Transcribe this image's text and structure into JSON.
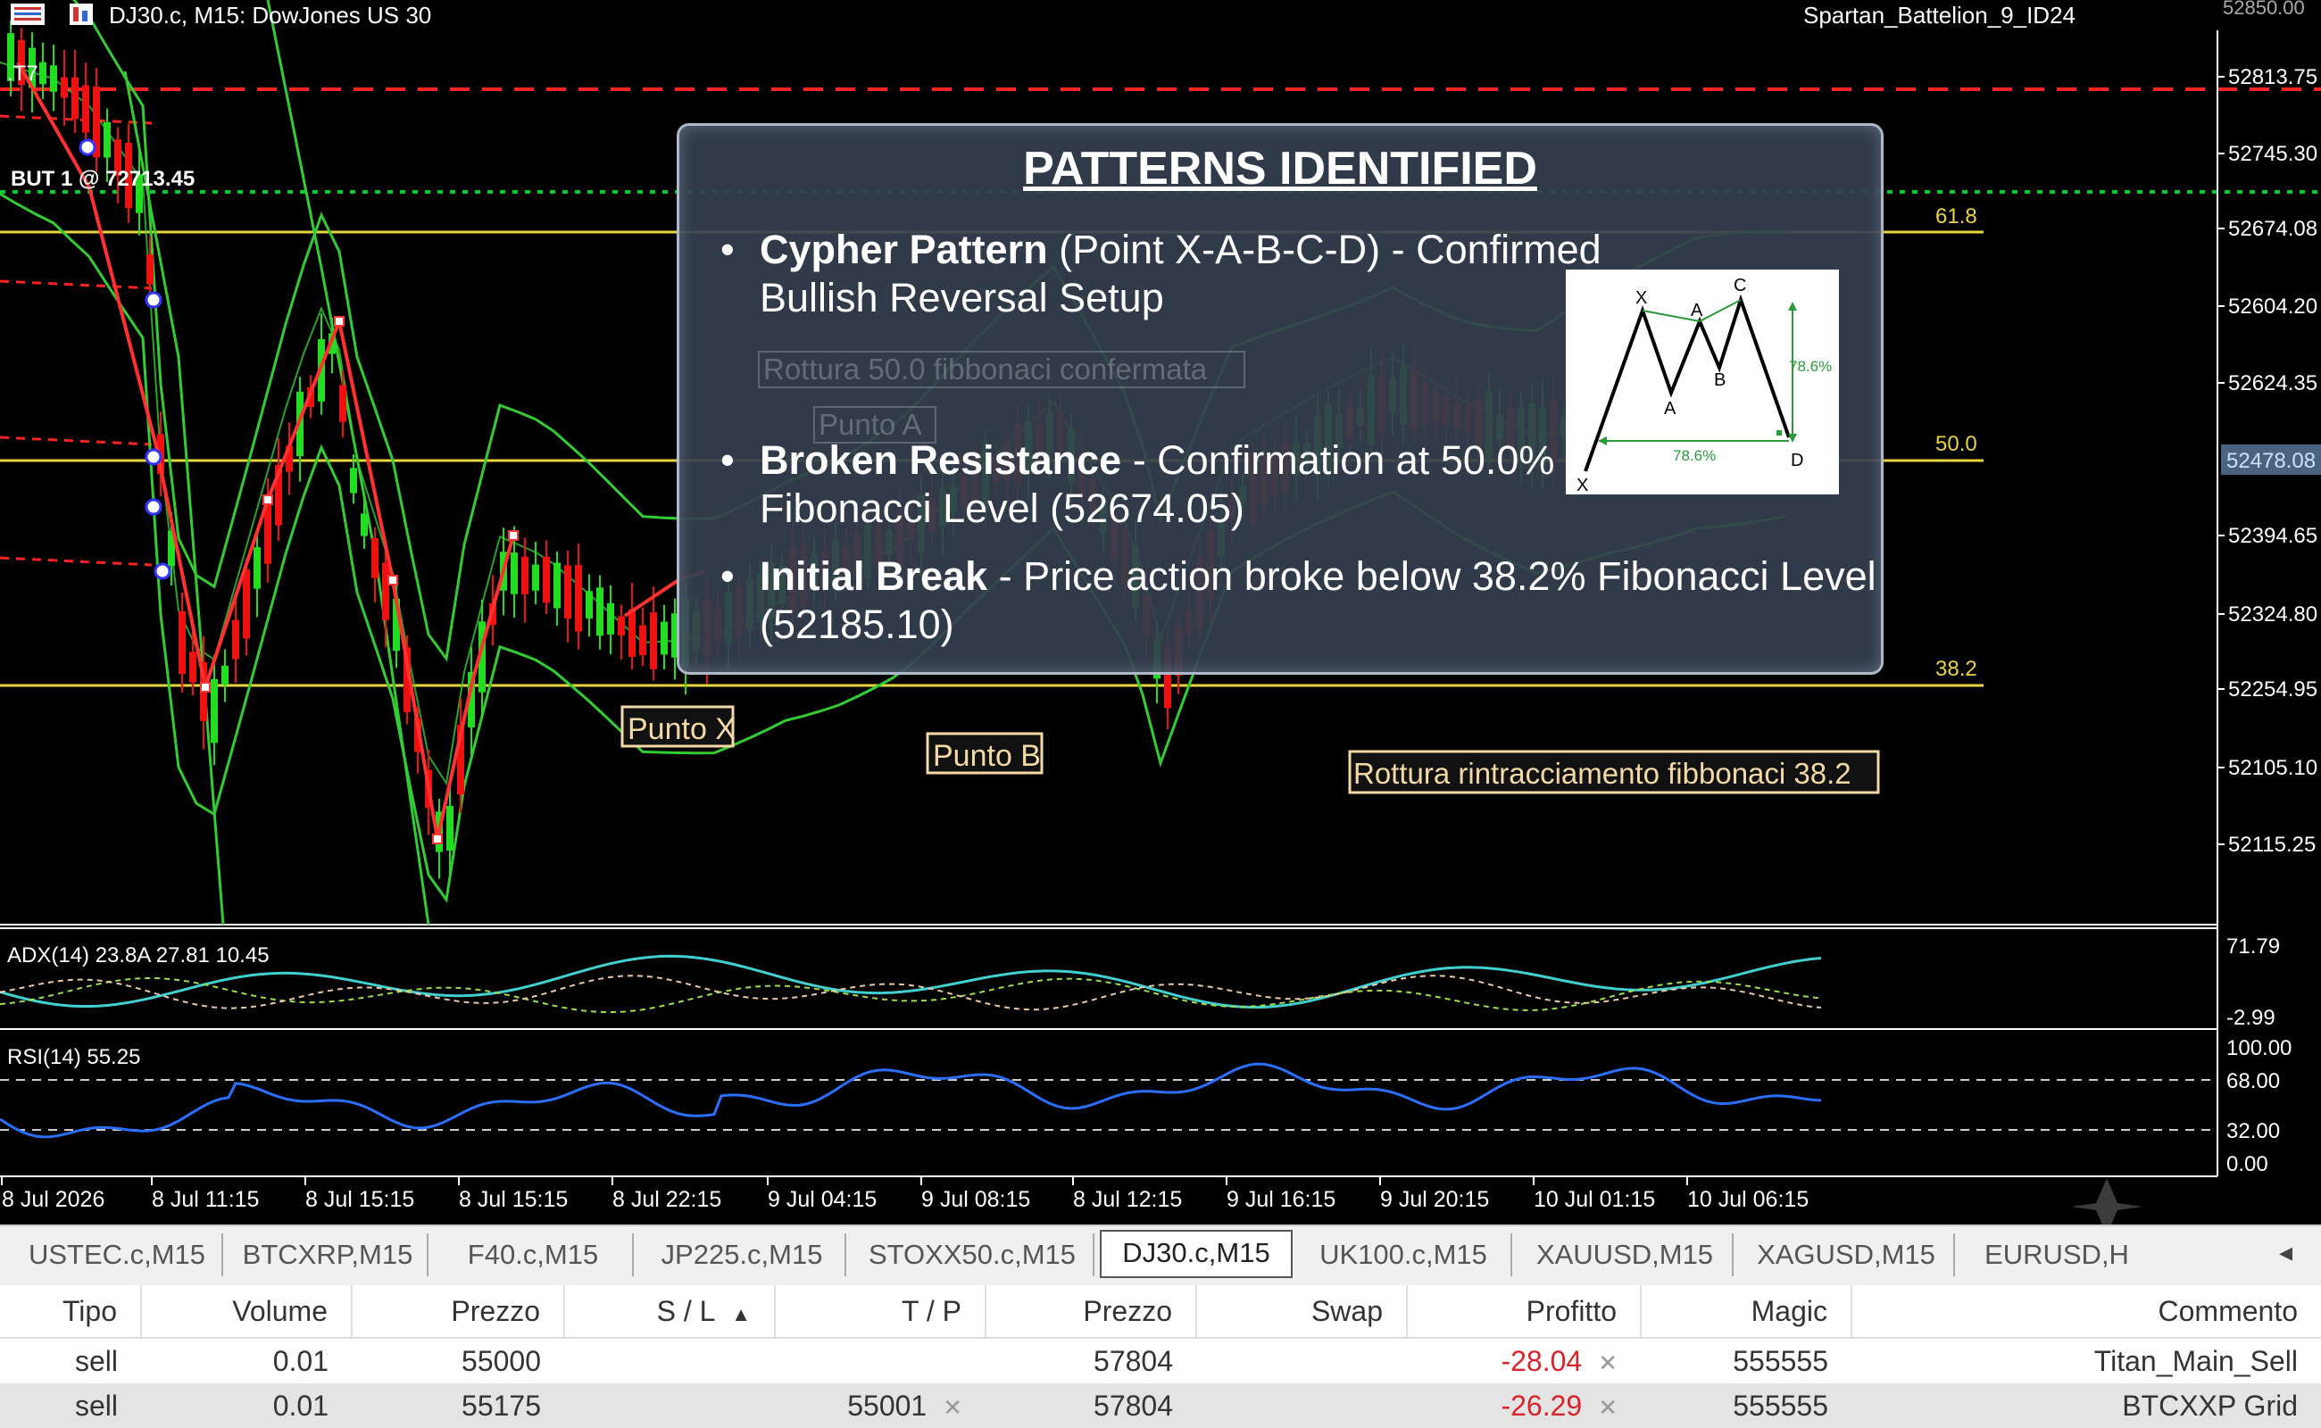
{
  "window": {
    "symbol_title": "DJ30.c, M15:  DowJones US 30",
    "ea_name": "Spartan_Battelion_9_ID24",
    "corner_price": "52850.00"
  },
  "chart": {
    "price_labels": [
      "52813.75",
      "52745.30",
      "52674.08",
      "52604.20",
      "52624.35",
      "52478.08",
      "52394.65",
      "52324.80",
      "52254.95",
      "52105.10",
      "52115.25"
    ],
    "current_price": "52478.08",
    "fib_labels": [
      "61.8",
      "50.0",
      "38.2"
    ],
    "left_labels": {
      "t7": ".T7",
      "buy": "BUT 1 @ 72713.45"
    },
    "annotations": {
      "punto_x": "Punto X",
      "punto_a": "Punto A",
      "punto_b": "Punto B",
      "rottura_50": "Rottura 50.0 fibbonaci confermata",
      "rottura_38": "Rottura rintracciamento fibbonaci 38.2"
    },
    "adx_label": "ADX(14) 23.8A 27.81 10.45",
    "adx_scale": [
      "71.79",
      "-2.99"
    ],
    "rsi_label": "RSI(14) 55.25",
    "rsi_scale": [
      "100.00",
      "68.00",
      "32.00",
      "0.00"
    ],
    "time_labels": [
      "8 Jul 2026",
      "8 Jul 11:15",
      "8 Jul 15:15",
      "8 Jul 15:15",
      "8 Jul 22:15",
      "9 Jul 04:15",
      "9 Jul 08:15",
      "8 Jul 12:15",
      "9 Jul 16:15",
      "9 Jul 20:15",
      "10 Jul 01:15",
      "10 Jul 06:15"
    ]
  },
  "overlay": {
    "title": "PATTERNS IDENTIFIED",
    "bullets": [
      {
        "bold": "Cypher Pattern",
        "rest": " (Point X-A-B-C-D) - Confirmed",
        "line2": "Bullish Reversal Setup"
      },
      {
        "bold": "Broken Resistance",
        "rest": " - Confirmation at 50.0%",
        "line2": "Fibonacci Level (52674.05)"
      },
      {
        "bold": "Initial Break",
        "rest": " - Price action broke below 38.2% Fibonacci Level",
        "line2": "(52185.10)"
      }
    ],
    "diagram": {
      "points": [
        "X",
        "A",
        "B",
        "C",
        "D",
        "A",
        "X"
      ],
      "ratios": [
        "78.6%",
        "78.6%"
      ]
    }
  },
  "tabs": {
    "items": [
      "USTEC.c,M15",
      "BTCXRP,M15",
      "F40.c,M15",
      "JP225.c,M15",
      "STOXX50.c,M15",
      "DJ30.c,M15",
      "UK100.c,M15",
      "XAUUSD,M15",
      "XAGUSD,M15",
      "EURUSD,H"
    ],
    "active": "DJ30.c,M15",
    "arrow": "◂"
  },
  "trades": {
    "headers": [
      "Tipo",
      "Volume",
      "Prezzo",
      "S / L",
      "T / P",
      "Prezzo",
      "Swap",
      "Profitto",
      "Magic",
      "Commento"
    ],
    "sort_indicator": "▲",
    "rows": [
      {
        "tipo": "sell",
        "volume": "0.01",
        "prezzo": "55000",
        "sl": "",
        "tp": "",
        "prezzo2": "57804",
        "swap": "",
        "profitto": "-28.04",
        "magic": "555555",
        "commento": "Titan_Main_Sell"
      },
      {
        "tipo": "sell",
        "volume": "0.01",
        "prezzo": "55175",
        "sl": "",
        "tp": "55001",
        "prezzo2": "57804",
        "swap": "",
        "profitto": "-26.29",
        "magic": "555555",
        "commento": "BTCXXP Grid"
      }
    ]
  },
  "colors": {
    "bull": "#22dd22",
    "bear": "#ee1111",
    "fib": "#e8d440",
    "band": "#33cc33",
    "red_dash": "#ff2222",
    "green_dash": "#00cc33",
    "adx": "#40d0d0",
    "rsi": "#2a6fff"
  }
}
